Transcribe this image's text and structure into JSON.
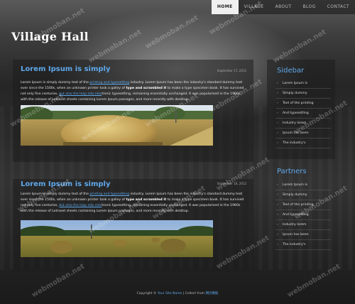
{
  "nav": {
    "items": [
      "HOME",
      "VILLAGE",
      "ABOUT",
      "BLOG",
      "CONTACT"
    ],
    "active": "HOME"
  },
  "site": {
    "title": "Village Hall"
  },
  "posts": [
    {
      "title": "Lorem Ipsum is simply",
      "date": "September 17, 2012",
      "text": {
        "a": "Lorem Ipsum is simply dummy text of the ",
        "link1": "printing and typesetting",
        "b": " industry. Lorem Ipsum has been the industry's standard dummy text ever since the 1500s, when an unknown printer took a galley of ",
        "bold": "type and scrambled it",
        "c": " to make a type specimen book. It has survived not only five centuries, ",
        "link2": "but also the leap into elec",
        "d": "tronic typesetting, remaining essentially unchanged. It was popularised in the 1960s with the release of Letraset sheets containing Lorem Ipsum passages, and more recently with desktop."
      }
    },
    {
      "title": "Lorem Ipsum is simply",
      "date": "September 16, 2012",
      "text": {
        "a": "Lorem Ipsum is simply dummy text of the ",
        "link1": "printing and typesetting",
        "b": " industry. Lorem Ipsum has been the industry's standard dummy text ever since the 1500s, when an unknown printer took a galley of ",
        "bold": "type and scrambled it",
        "c": " to make a type specimen book. It has survived not only five centuries, ",
        "link2": "but also the leap into elec",
        "d": "tronic typesetting, remaining essentially unchanged. It was popularised in the 1960s with the release of Letraset sheets containing Lorem Ipsum passages, and more recently with desktop."
      }
    }
  ],
  "sidebar": {
    "title": "Sidebar",
    "items": [
      "Lorem Ipsum is",
      "Simply dummy",
      "Text of the printing",
      "And typesetting",
      "Industry lorem",
      "Ipsum has been",
      "The industry's"
    ]
  },
  "partners": {
    "title": "Partners",
    "items": [
      "Lorem Ipsum is",
      "Simply dummy",
      "Text of the printing",
      "And typesetting",
      "Industry lorem",
      "Ipsum has been",
      "The industry's"
    ]
  },
  "footer": {
    "prefix": "Copyright © ",
    "link1": "Your Site Name",
    "mid": " | Collect from ",
    "link2": "网页模板"
  },
  "watermark": "webmoban.net"
}
